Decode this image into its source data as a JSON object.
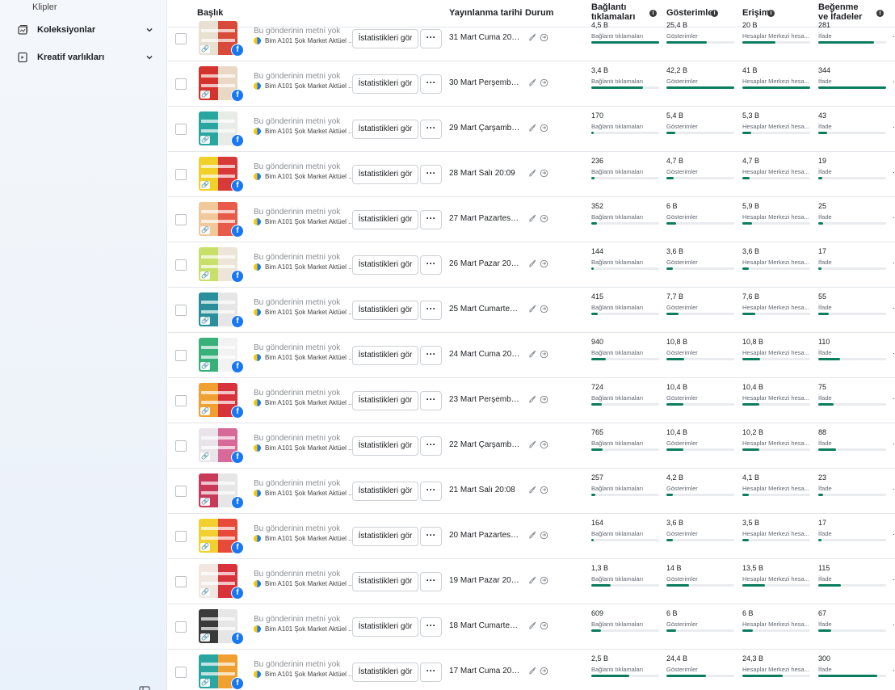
{
  "sidebar": {
    "sub_item": "Klipler",
    "items": [
      {
        "label": "Koleksiyonlar",
        "icon": "collection-icon"
      },
      {
        "label": "Kreatif varlıkları",
        "icon": "creative-assets-icon"
      }
    ]
  },
  "headers": {
    "title": "Başlık",
    "published": "Yayınlanma tarihi",
    "status": "Durum",
    "link_clicks": "Bağlantı tıklamaları",
    "impressions": "Gösterimler",
    "reach": "Erişim",
    "reactions": "Beğenme ve İfadeler"
  },
  "common": {
    "post_text": "Bu gönderinin metni yok",
    "page_name": "Bim A101 Şok Market Aktüel ...",
    "stats_button": "İstatistikleri gör",
    "more_button": "···",
    "clicks_sub": "Bağlantı tıklamaları",
    "impr_sub": "Gösterimler",
    "reach_sub": "Hesaplar Merkezi hesa...",
    "react_sub": "İfade",
    "edge": "."
  },
  "colors": {
    "bar": "#0b7d5f",
    "facebook": "#1877f2"
  },
  "rows": [
    {
      "date": "31 Mart Cuma 20:03",
      "clicks": "4,5 B",
      "clicks_frac": 1.0,
      "impr": "25,4 B",
      "impr_frac": 0.6,
      "reach": "20 B",
      "reach_frac": 0.49,
      "react": "281",
      "react_frac": 0.82,
      "thumb": [
        "#e8e0d0",
        "#d84a3a"
      ]
    },
    {
      "date": "30 Mart Perşembe ...",
      "clicks": "3,4 B",
      "clicks_frac": 0.76,
      "impr": "42,2 B",
      "impr_frac": 1.0,
      "reach": "41 B",
      "reach_frac": 1.0,
      "react": "344",
      "react_frac": 1.0,
      "thumb": [
        "#d4322c",
        "#e9d9c4"
      ]
    },
    {
      "date": "29 Mart Çarşamba ...",
      "clicks": "170",
      "clicks_frac": 0.04,
      "impr": "5,4 B",
      "impr_frac": 0.13,
      "reach": "5,3 B",
      "reach_frac": 0.13,
      "react": "43",
      "react_frac": 0.13,
      "thumb": [
        "#2aa6a0",
        "#e8ece6"
      ]
    },
    {
      "date": "28 Mart Salı 20:09",
      "clicks": "236",
      "clicks_frac": 0.05,
      "impr": "4,7 B",
      "impr_frac": 0.11,
      "reach": "4,7 B",
      "reach_frac": 0.11,
      "react": "19",
      "react_frac": 0.06,
      "thumb": [
        "#f2d02a",
        "#d83a3a"
      ]
    },
    {
      "date": "27 Mart Pazartesi 2...",
      "clicks": "352",
      "clicks_frac": 0.08,
      "impr": "6 B",
      "impr_frac": 0.14,
      "reach": "5,9 B",
      "reach_frac": 0.14,
      "react": "25",
      "react_frac": 0.07,
      "thumb": [
        "#f0c89a",
        "#e85a4a"
      ]
    },
    {
      "date": "26 Mart Pazar 20:05",
      "clicks": "144",
      "clicks_frac": 0.03,
      "impr": "3,6 B",
      "impr_frac": 0.09,
      "reach": "3,6 B",
      "reach_frac": 0.09,
      "react": "17",
      "react_frac": 0.05,
      "thumb": [
        "#c8e06a",
        "#ede6d8"
      ]
    },
    {
      "date": "25 Mart Cumartesi ...",
      "clicks": "415",
      "clicks_frac": 0.09,
      "impr": "7,7 B",
      "impr_frac": 0.18,
      "reach": "7,6 B",
      "reach_frac": 0.19,
      "react": "55",
      "react_frac": 0.16,
      "thumb": [
        "#2a8f9a",
        "#e6e6e6"
      ]
    },
    {
      "date": "24 Mart Cuma 20:03",
      "clicks": "940",
      "clicks_frac": 0.21,
      "impr": "10,8 B",
      "impr_frac": 0.26,
      "reach": "10,8 B",
      "reach_frac": 0.26,
      "react": "110",
      "react_frac": 0.32,
      "thumb": [
        "#38b07a",
        "#f2f2f2"
      ]
    },
    {
      "date": "23 Mart Perşembe ...",
      "clicks": "724",
      "clicks_frac": 0.16,
      "impr": "10,4 B",
      "impr_frac": 0.25,
      "reach": "10,4 B",
      "reach_frac": 0.25,
      "react": "75",
      "react_frac": 0.22,
      "thumb": [
        "#f0a030",
        "#d8323a"
      ]
    },
    {
      "date": "22 Mart Çarşamba ...",
      "clicks": "765",
      "clicks_frac": 0.17,
      "impr": "10,4 B",
      "impr_frac": 0.25,
      "reach": "10,2 B",
      "reach_frac": 0.25,
      "react": "88",
      "react_frac": 0.26,
      "thumb": [
        "#e8e4ea",
        "#d86a9a"
      ]
    },
    {
      "date": "21 Mart Salı 20:08",
      "clicks": "257",
      "clicks_frac": 0.06,
      "impr": "4,2 B",
      "impr_frac": 0.1,
      "reach": "4,1 B",
      "reach_frac": 0.1,
      "react": "23",
      "react_frac": 0.07,
      "thumb": [
        "#c83a5a",
        "#e6e6e6"
      ]
    },
    {
      "date": "20 Mart Pazartesi 2...",
      "clicks": "164",
      "clicks_frac": 0.04,
      "impr": "3,6 B",
      "impr_frac": 0.09,
      "reach": "3,5 B",
      "reach_frac": 0.09,
      "react": "17",
      "react_frac": 0.05,
      "thumb": [
        "#f2d030",
        "#e84a3a"
      ]
    },
    {
      "date": "19 Mart Pazar 20:05",
      "clicks": "1,3 B",
      "clicks_frac": 0.29,
      "impr": "14 B",
      "impr_frac": 0.33,
      "reach": "13,5 B",
      "reach_frac": 0.33,
      "react": "115",
      "react_frac": 0.33,
      "thumb": [
        "#f2e6e0",
        "#d8323a"
      ]
    },
    {
      "date": "18 Mart Cumartesi ...",
      "clicks": "609",
      "clicks_frac": 0.14,
      "impr": "6 B",
      "impr_frac": 0.14,
      "reach": "6 B",
      "reach_frac": 0.15,
      "react": "67",
      "react_frac": 0.19,
      "thumb": [
        "#3a3a3a",
        "#e6e6e6"
      ]
    },
    {
      "date": "17 Mart Cuma 20:10",
      "clicks": "2,5 B",
      "clicks_frac": 0.56,
      "impr": "24,4 B",
      "impr_frac": 0.58,
      "reach": "24,3 B",
      "reach_frac": 0.59,
      "react": "300",
      "react_frac": 0.87,
      "thumb": [
        "#2aa6a0",
        "#f0a030"
      ]
    }
  ]
}
